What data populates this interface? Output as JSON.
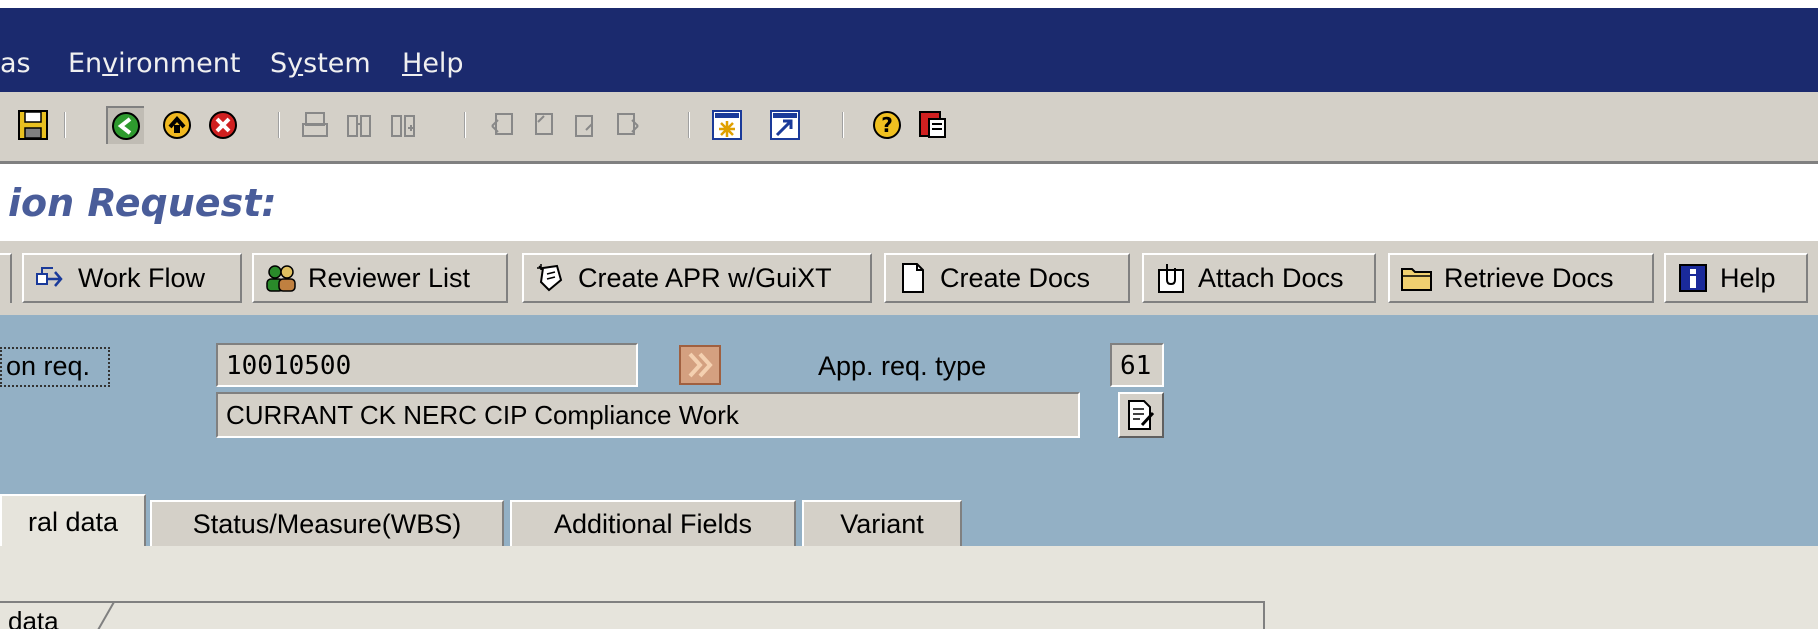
{
  "menu": {
    "items": [
      {
        "label": "as",
        "underline_index": -1
      },
      {
        "label": "Environment",
        "underline_index": 2
      },
      {
        "label": "System",
        "underline_index": 1
      },
      {
        "label": "Help",
        "underline_index": 0
      }
    ]
  },
  "toolbar": {
    "icons": [
      "save-icon",
      "back-icon",
      "exit-icon",
      "cancel-icon",
      "print-icon",
      "find-icon",
      "find-next-icon",
      "first-page-icon",
      "previous-page-icon",
      "next-page-icon",
      "last-page-icon",
      "create-session-icon",
      "shortcut-icon",
      "help-icon",
      "layout-menu-icon"
    ]
  },
  "title": "ion Request:",
  "app_toolbar": {
    "buttons": [
      {
        "label": "Work Flow",
        "icon": "workflow-icon"
      },
      {
        "label": "Reviewer List",
        "icon": "users-icon"
      },
      {
        "label": "Create APR w/GuiXT",
        "icon": "create-apr-icon"
      },
      {
        "label": "Create Docs",
        "icon": "document-icon"
      },
      {
        "label": "Attach Docs",
        "icon": "attach-icon"
      },
      {
        "label": "Retrieve Docs",
        "icon": "folder-icon"
      },
      {
        "label": "Help",
        "icon": "info-icon"
      }
    ]
  },
  "header": {
    "req_label": "on req.",
    "req_value": "10010500",
    "type_label": "App. req. type",
    "type_value": "61",
    "description": "CURRANT CK NERC CIP Compliance Work"
  },
  "tabs": [
    {
      "label": "ral data",
      "active": true
    },
    {
      "label": "Status/Measure(WBS)",
      "active": false
    },
    {
      "label": "Additional Fields",
      "active": false
    },
    {
      "label": "Variant",
      "active": false
    }
  ],
  "subframe_label": "data",
  "colors": {
    "menubar": "#1b2a6e",
    "toolbar": "#d4d0c8",
    "header_area": "#93b0c5",
    "title": "#4a5d9a"
  }
}
